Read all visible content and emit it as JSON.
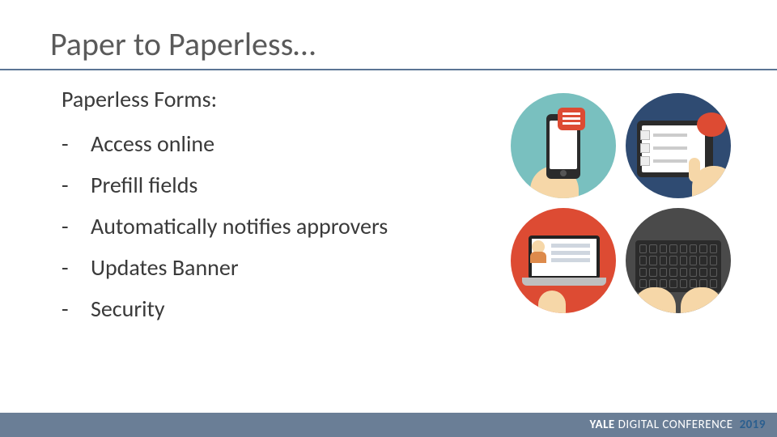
{
  "title": "Paper to Paperless…",
  "subheading": "Paperless Forms:",
  "bullets": [
    "Access online",
    "Prefill fields",
    "Automatically notifies approvers",
    "Updates Banner",
    "Security"
  ],
  "footer": {
    "brand_strong": "YALE",
    "brand_rest": " DIGITAL CONFERENCE",
    "year": "2019"
  },
  "icons": [
    "phone-chat-icon",
    "tablet-touch-icon",
    "laptop-profile-icon",
    "keyboard-typing-icon"
  ]
}
